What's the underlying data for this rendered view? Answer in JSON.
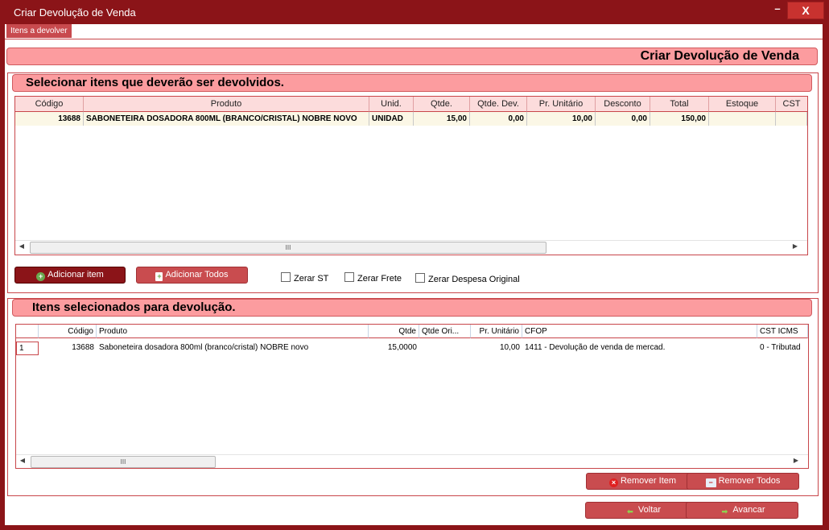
{
  "window": {
    "title": "Criar Devolução de Venda",
    "minimize": "–",
    "close": "X"
  },
  "tabs": [
    {
      "label": "Itens a devolver"
    }
  ],
  "header": {
    "title": "Criar Devolução de Venda"
  },
  "section1": {
    "title": "Selecionar itens que deverão ser devolvidos.",
    "columns": [
      "Código",
      "Produto",
      "Unid.",
      "Qtde.",
      "Qtde. Dev.",
      "Pr. Unitário",
      "Desconto",
      "Total",
      "Estoque",
      "CST"
    ],
    "rows": [
      [
        "13688",
        "SABONETEIRA DOSADORA 800ML (BRANCO/CRISTAL) NOBRE NOVO",
        "UNIDAD",
        "15,00",
        "0,00",
        "10,00",
        "0,00",
        "150,00",
        "",
        ""
      ]
    ],
    "scroll_grip": "III",
    "buttons": {
      "add_item": "Adicionar item",
      "add_all": "Adicionar Todos"
    },
    "checkboxes": {
      "zerar_st": "Zerar ST",
      "zerar_frete": "Zerar Frete",
      "zerar_despesa": "Zerar Despesa Original"
    }
  },
  "section2": {
    "title": "Itens selecionados para devolução.",
    "columns": [
      "",
      "Código",
      "Produto",
      "Qtde",
      "Qtde Ori...",
      "Pr. Unitário",
      "CFOP",
      "CST ICMS"
    ],
    "rows": [
      [
        "1",
        "13688",
        "Saboneteira dosadora 800ml (branco/cristal) NOBRE novo",
        "15,0000",
        "",
        "10,00",
        "1411 - Devolução de venda de mercad.",
        "0 - Tributad"
      ]
    ],
    "scroll_grip": "III",
    "buttons": {
      "remove_item": "Remover Item",
      "remove_all": "Remover Todos"
    }
  },
  "footer": {
    "back": "Voltar",
    "next": "Avancar"
  },
  "colors": {
    "frame": "#8b1418",
    "banner": "#fc9c9f",
    "button": "#c94c4f"
  }
}
